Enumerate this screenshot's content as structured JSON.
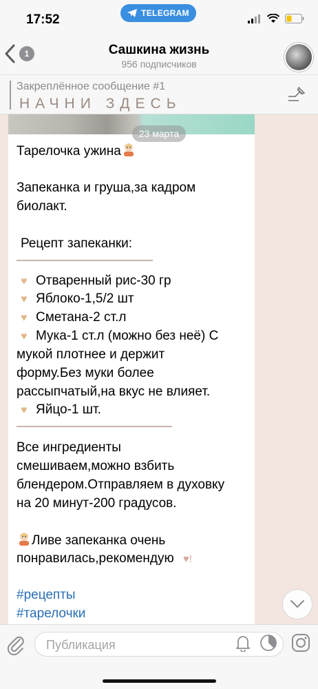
{
  "status_bar": {
    "time": "17:52",
    "telegram_label": "TELEGRAM"
  },
  "header": {
    "back_count": "1",
    "title": "Сашкина жизнь",
    "subtitle": "956 подписчиков"
  },
  "pinned": {
    "label": "Закреплённое сообщение #1",
    "text": "НАЧНИ ЗДЕСЬ"
  },
  "message": {
    "date": "23 марта",
    "line1": "Тарелочка ужина",
    "p2_l1": "Запеканка и груша,за кадром",
    "p2_l2": "биолакт.",
    "recipe_title": "Рецепт запеканки:",
    "ing1": "Отваренный рис-30 гр",
    "ing2": "Яблоко-1,5/2 шт",
    "ing3": "Сметана-2 ст.л",
    "ing4_l1": "Мука-1 ст.л (можно без неё) С",
    "ing4_l2": "мукой плотнее и держит",
    "ing4_l3": "форму.Без муки более",
    "ing4_l4": "рассыпчатый,на вкус не влияет.",
    "ing5": "Яйцо-1 шт.",
    "p4_l1": "Все ингредиенты",
    "p4_l2": "смешиваем,можно взбить",
    "p4_l3": "блендером.Отправляем в духовку",
    "p4_l4": "на 20 минут-200 градусов.",
    "p5_l1": "Ливе запеканка очень",
    "p5_l2": "понравилась,рекомендую",
    "hashtag1": "#рецепты",
    "hashtag2": "#тарелочки",
    "bullet_heart": "♥",
    "heart_end": "♥!"
  },
  "input": {
    "placeholder": "Публикация"
  },
  "colors": {
    "background": "#f3e6e1",
    "accent": "#3a8fe0",
    "hashtag": "#2a6fb5",
    "heart": "#e0b98a",
    "divider": "#c8b3a8"
  }
}
